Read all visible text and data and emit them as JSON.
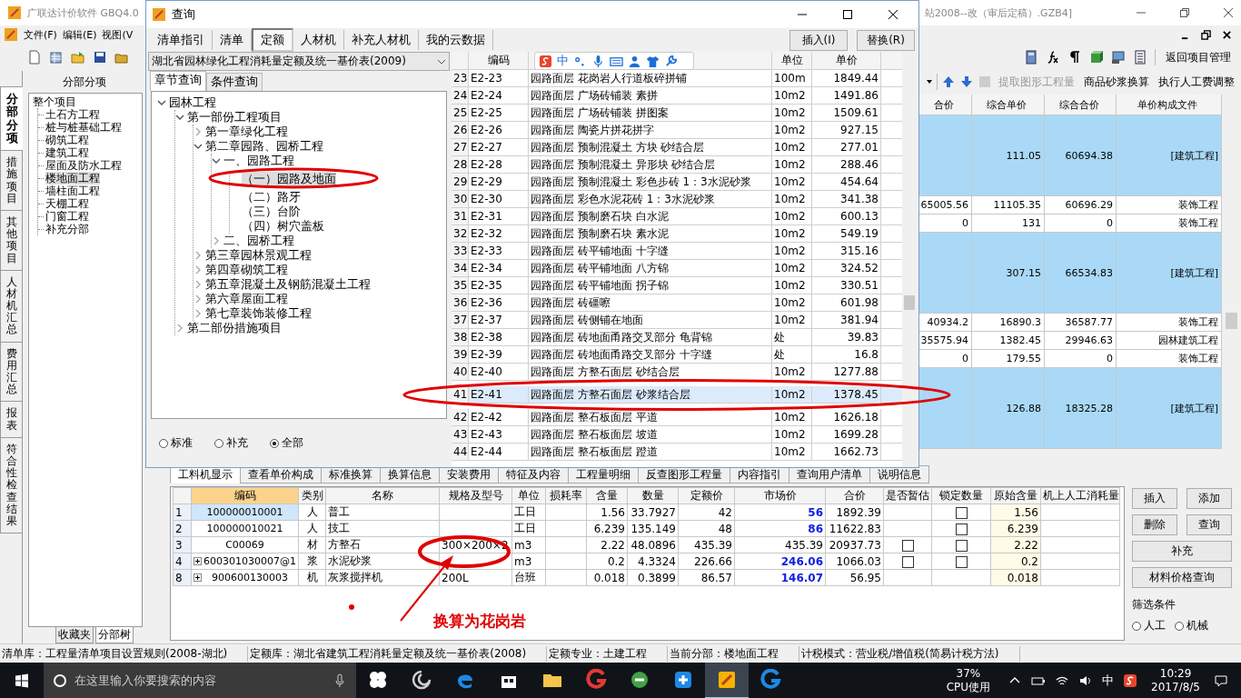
{
  "main_window": {
    "title": "广联达计价软件 GBQ4.0",
    "title_tail": "站2008--改（审后定稿）.GZB4]"
  },
  "menu": [
    "文件(F)",
    "编辑(E)",
    "视图(V"
  ],
  "toolbar": {
    "return_button": "返回项目管理"
  },
  "toolbar2": [
    {
      "label": "提取图形工程量",
      "disabled": true
    },
    {
      "label": "商品砂浆换算",
      "disabled": false
    },
    {
      "label": "执行人工费调整",
      "disabled": false
    }
  ],
  "side_tabs": [
    {
      "label": "分部分项",
      "selected": true
    },
    {
      "label": "措施项目",
      "selected": false
    },
    {
      "label": "其他项目",
      "selected": false
    },
    {
      "label": "人材机汇总",
      "selected": false
    },
    {
      "label": "费用汇总",
      "selected": false
    },
    {
      "label": "报表",
      "selected": false
    },
    {
      "label": "符合性检查结果",
      "selected": false
    }
  ],
  "project_tree": {
    "title": "分部分项",
    "root": {
      "label": "整个项目",
      "selected": false,
      "children": [
        {
          "label": "土石方工程",
          "selected": false
        },
        {
          "label": "桩与桩基础工程",
          "selected": false
        },
        {
          "label": "砌筑工程",
          "selected": false
        },
        {
          "label": "建筑工程",
          "selected": false
        },
        {
          "label": "屋面及防水工程",
          "selected": false
        },
        {
          "label": "楼地面工程",
          "selected": true
        },
        {
          "label": "墙柱面工程",
          "selected": false
        },
        {
          "label": "天棚工程",
          "selected": false
        },
        {
          "label": "门窗工程",
          "selected": false
        },
        {
          "label": "补充分部",
          "selected": false
        }
      ]
    },
    "tabs": [
      {
        "label": "收藏夹",
        "selected": false
      },
      {
        "label": "分部树",
        "selected": true
      }
    ]
  },
  "grid": {
    "columns": [
      "合价",
      "综合单价",
      "综合合价",
      "单价构成文件"
    ],
    "rows": [
      {
        "kind": "group",
        "unit_price": "111.05",
        "amount": "60694.38",
        "file": "[建筑工程]"
      },
      {
        "kind": "item",
        "total": "65005.56",
        "unit_price": "11105.35",
        "amount": "60696.29",
        "file": "装饰工程"
      },
      {
        "kind": "item",
        "total": "0",
        "unit_price": "131",
        "amount": "0",
        "file": "装饰工程"
      },
      {
        "kind": "group",
        "unit_price": "307.15",
        "amount": "66534.83",
        "file": "[建筑工程]"
      },
      {
        "kind": "item",
        "total": "40934.2",
        "unit_price": "16890.3",
        "amount": "36587.77",
        "file": "装饰工程"
      },
      {
        "kind": "item",
        "total": "35575.94",
        "unit_price": "1382.45",
        "amount": "29946.63",
        "file": "园林建筑工程"
      },
      {
        "kind": "item",
        "total": "0",
        "unit_price": "179.55",
        "amount": "0",
        "file": "装饰工程"
      },
      {
        "kind": "group",
        "unit_price": "126.88",
        "amount": "18325.28",
        "file": "[建筑工程]"
      }
    ]
  },
  "detail_tabs": [
    {
      "label": "工料机显示",
      "selected": true
    },
    {
      "label": "查看单价构成",
      "selected": false
    },
    {
      "label": "标准换算",
      "selected": false
    },
    {
      "label": "换算信息",
      "selected": false
    },
    {
      "label": "安装费用",
      "selected": false
    },
    {
      "label": "特征及内容",
      "selected": false
    },
    {
      "label": "工程量明细",
      "selected": false
    },
    {
      "label": "反查图形工程量",
      "selected": false
    },
    {
      "label": "内容指引",
      "selected": false
    },
    {
      "label": "查询用户清单",
      "selected": false
    },
    {
      "label": "说明信息",
      "selected": false
    }
  ],
  "detail_table": {
    "columns": [
      "编码",
      "类别",
      "名称",
      "规格及型号",
      "单位",
      "损耗率",
      "含量",
      "数量",
      "定额价",
      "市场价",
      "合价",
      "是否暂估",
      "锁定数量",
      "原始含量",
      "机上人工消耗量"
    ],
    "rows": [
      {
        "no": "1",
        "expandable": false,
        "selected": true,
        "code": "100000010001",
        "type": "人",
        "name": "普工",
        "unit": "工日",
        "content": "1.56",
        "quantity": "33.7927",
        "quota_price": "42",
        "market_price": "56",
        "adjusted": true,
        "total": "1892.39",
        "lock_checked": false,
        "original": "1.56"
      },
      {
        "no": "2",
        "expandable": false,
        "selected": false,
        "code": "100000010021",
        "type": "人",
        "name": "技工",
        "unit": "工日",
        "content": "6.239",
        "quantity": "135.149",
        "quota_price": "48",
        "market_price": "86",
        "adjusted": true,
        "total": "11622.83",
        "lock_checked": false,
        "original": "6.239"
      },
      {
        "no": "3",
        "expandable": false,
        "selected": false,
        "code": "C00069",
        "type": "材",
        "name": "方整石",
        "spec": "300×200×2",
        "unit": "m3",
        "content": "2.22",
        "quantity": "48.0896",
        "quota_price": "435.39",
        "market_price": "435.39",
        "adjusted": false,
        "total": "20937.73",
        "estimate_checked": false,
        "lock_checked": false,
        "original": "2.22"
      },
      {
        "no": "4",
        "expandable": true,
        "selected": false,
        "code": "600301030007@1",
        "type": "浆",
        "name": "水泥砂浆",
        "unit": "m3",
        "content": "0.2",
        "quantity": "4.3324",
        "quota_price": "226.66",
        "market_price": "246.06",
        "adjusted": true,
        "total": "1066.03",
        "estimate_checked": false,
        "lock_checked": false,
        "original": "0.2"
      },
      {
        "no": "8",
        "expandable": true,
        "selected": false,
        "code": "900600130003",
        "type": "机",
        "name": "灰浆搅拌机",
        "spec": "200L",
        "unit": "台班",
        "content": "0.018",
        "quantity": "0.3899",
        "quota_price": "86.57",
        "market_price": "146.07",
        "adjusted": true,
        "total": "56.95",
        "original": "0.018"
      }
    ]
  },
  "side_buttons": [
    {
      "label": "插入",
      "wide": false
    },
    {
      "label": "添加",
      "wide": false
    },
    {
      "label": "删除",
      "wide": false
    },
    {
      "label": "查询",
      "wide": false
    },
    {
      "label": "补充",
      "wide": true
    },
    {
      "label": "材料价格查询",
      "wide": true
    }
  ],
  "filter": {
    "title": "筛选条件",
    "options": [
      {
        "label": "人工",
        "selected": false
      },
      {
        "label": "机械",
        "selected": false
      }
    ]
  },
  "status_bar": [
    "清单库：工程量清单项目设置规则(2008-湖北)",
    "定额库：湖北省建筑工程消耗量定额及统一基价表(2008)",
    "定额专业：土建工程",
    "当前分部：楼地面工程",
    "计税模式：营业税/增值税(简易计税方法)"
  ],
  "dialog": {
    "title": "查询",
    "tabs": [
      {
        "label": "清单指引",
        "selected": false
      },
      {
        "label": "清单",
        "selected": false
      },
      {
        "label": "定额",
        "selected": true
      },
      {
        "label": "人材机",
        "selected": false
      },
      {
        "label": "补充人材机",
        "selected": false
      },
      {
        "label": "我的云数据",
        "selected": false
      }
    ],
    "buttons": [
      "插入(I)",
      "替换(R)"
    ],
    "library": "湖北省园林绿化工程消耗量定额及统一基价表(2009)",
    "search_tabs": [
      {
        "label": "章节查询",
        "selected": true
      },
      {
        "label": "条件查询",
        "selected": false
      }
    ],
    "tree": [
      {
        "label": "园林工程",
        "expanded": true,
        "selected": false,
        "children": [
          {
            "label": "第一部份工程项目",
            "expanded": true,
            "selected": false,
            "children": [
              {
                "label": "第一章绿化工程",
                "expanded": false,
                "selected": false
              },
              {
                "label": "第二章园路、园桥工程",
                "expanded": true,
                "selected": false,
                "children": [
                  {
                    "label": "一、园路工程",
                    "expanded": true,
                    "selected": false,
                    "children": [
                      {
                        "label": "（一）园路及地面",
                        "selected": true
                      },
                      {
                        "label": "（二）路牙",
                        "selected": false
                      },
                      {
                        "label": "（三）台阶",
                        "selected": false
                      },
                      {
                        "label": "（四）树穴盖板",
                        "selected": false
                      }
                    ]
                  },
                  {
                    "label": "二、园桥工程",
                    "expanded": false,
                    "selected": false
                  }
                ]
              },
              {
                "label": "第三章园林景观工程",
                "expanded": false,
                "selected": false
              },
              {
                "label": "第四章砌筑工程",
                "expanded": false,
                "selected": false
              },
              {
                "label": "第五章混凝土及钢筋混凝土工程",
                "expanded": false,
                "selected": false
              },
              {
                "label": "第六章屋面工程",
                "expanded": false,
                "selected": false
              },
              {
                "label": "第七章装饰装修工程",
                "expanded": false,
                "selected": false
              }
            ]
          },
          {
            "label": "第二部份措施项目",
            "expanded": false,
            "selected": false
          }
        ]
      }
    ],
    "scope": [
      {
        "label": "标准",
        "selected": false
      },
      {
        "label": "补充",
        "selected": false
      },
      {
        "label": "全部",
        "selected": true
      }
    ],
    "table": {
      "columns": {
        "code": "编码",
        "unit": "单位",
        "price": "单价"
      },
      "rows": [
        {
          "no": "23",
          "code": "E2-23",
          "name": "园路面层 花岗岩人行道板碎拼铺",
          "unit": "100m",
          "price": "1849.44",
          "selected": false
        },
        {
          "no": "24",
          "code": "E2-24",
          "name": "园路面层 广场砖铺装 素拼",
          "unit": "10m2",
          "price": "1491.86",
          "selected": false
        },
        {
          "no": "25",
          "code": "E2-25",
          "name": "园路面层 广场砖铺装 拼图案",
          "unit": "10m2",
          "price": "1509.61",
          "selected": false
        },
        {
          "no": "26",
          "code": "E2-26",
          "name": "园路面层 陶瓷片拼花拼字",
          "unit": "10m2",
          "price": "927.15",
          "selected": false
        },
        {
          "no": "27",
          "code": "E2-27",
          "name": "园路面层 预制混凝土 方块 砂结合层",
          "unit": "10m2",
          "price": "277.01",
          "selected": false
        },
        {
          "no": "28",
          "code": "E2-28",
          "name": "园路面层 预制混凝土 异形块 砂结合层",
          "unit": "10m2",
          "price": "288.46",
          "selected": false
        },
        {
          "no": "29",
          "code": "E2-29",
          "name": "园路面层 预制混凝土 彩色步砖 1：3水泥砂浆",
          "unit": "10m2",
          "price": "454.64",
          "selected": false
        },
        {
          "no": "30",
          "code": "E2-30",
          "name": "园路面层 彩色水泥花砖 1：3水泥砂浆",
          "unit": "10m2",
          "price": "341.38",
          "selected": false
        },
        {
          "no": "31",
          "code": "E2-31",
          "name": "园路面层 预制磨石块 白水泥",
          "unit": "10m2",
          "price": "600.13",
          "selected": false
        },
        {
          "no": "32",
          "code": "E2-32",
          "name": "园路面层 预制磨石块 素水泥",
          "unit": "10m2",
          "price": "549.19",
          "selected": false
        },
        {
          "no": "33",
          "code": "E2-33",
          "name": "园路面层 砖平铺地面 十字缝",
          "unit": "10m2",
          "price": "315.16",
          "selected": false
        },
        {
          "no": "34",
          "code": "E2-34",
          "name": "园路面层 砖平铺地面 八方锦",
          "unit": "10m2",
          "price": "324.52",
          "selected": false
        },
        {
          "no": "35",
          "code": "E2-35",
          "name": "园路面层 砖平铺地面 拐子锦",
          "unit": "10m2",
          "price": "330.51",
          "selected": false
        },
        {
          "no": "36",
          "code": "E2-36",
          "name": "园路面层 砖礓嚓",
          "unit": "10m2",
          "price": "601.98",
          "selected": false
        },
        {
          "no": "37",
          "code": "E2-37",
          "name": "园路面层 砖侧铺在地面",
          "unit": "10m2",
          "price": "381.94",
          "selected": false
        },
        {
          "no": "38",
          "code": "E2-38",
          "name": "园路面层 砖地面甬路交叉部分 龟背锦",
          "unit": "处",
          "price": "39.83",
          "selected": false
        },
        {
          "no": "39",
          "code": "E2-39",
          "name": "园路面层 砖地面甬路交叉部分 十字缝",
          "unit": "处",
          "price": "16.8",
          "selected": false
        },
        {
          "no": "40",
          "code": "E2-40",
          "name": "园路面层 方整石面层 砂结合层",
          "unit": "10m2",
          "price": "1277.88",
          "selected": false
        },
        {
          "no": "41",
          "code": "E2-41",
          "name": "园路面层 方整石面层 砂浆结合层",
          "unit": "10m2",
          "price": "1378.45",
          "selected": true
        },
        {
          "no": "42",
          "code": "E2-42",
          "name": "园路面层 整石板面层 平道",
          "unit": "10m2",
          "price": "1626.18",
          "selected": false
        },
        {
          "no": "43",
          "code": "E2-43",
          "name": "园路面层 整石板面层 坡道",
          "unit": "10m2",
          "price": "1699.28",
          "selected": false
        },
        {
          "no": "44",
          "code": "E2-44",
          "name": "园路面层 整石板面层 蹬道",
          "unit": "10m2",
          "price": "1662.73",
          "selected": false
        }
      ]
    }
  },
  "ime_bar": {
    "mode": "中"
  },
  "annotation": {
    "text": "换算为花岗岩"
  },
  "taskbar": {
    "search_placeholder": "在这里输入你要搜索的内容",
    "apps": [
      {
        "kind": "fan",
        "active": false
      },
      {
        "kind": "swirl",
        "active": false
      },
      {
        "kind": "edge",
        "active": false
      },
      {
        "kind": "store",
        "active": false
      },
      {
        "kind": "folder",
        "active": false
      },
      {
        "kind": "red",
        "active": false
      },
      {
        "kind": "green",
        "active": false
      },
      {
        "kind": "blue",
        "active": false
      },
      {
        "kind": "yellow",
        "active": true
      },
      {
        "kind": "g",
        "active": false
      }
    ],
    "cpu": "37%",
    "cpu_label": "CPU使用",
    "ime": "中",
    "time": "10:29",
    "date": "2017/8/5"
  }
}
